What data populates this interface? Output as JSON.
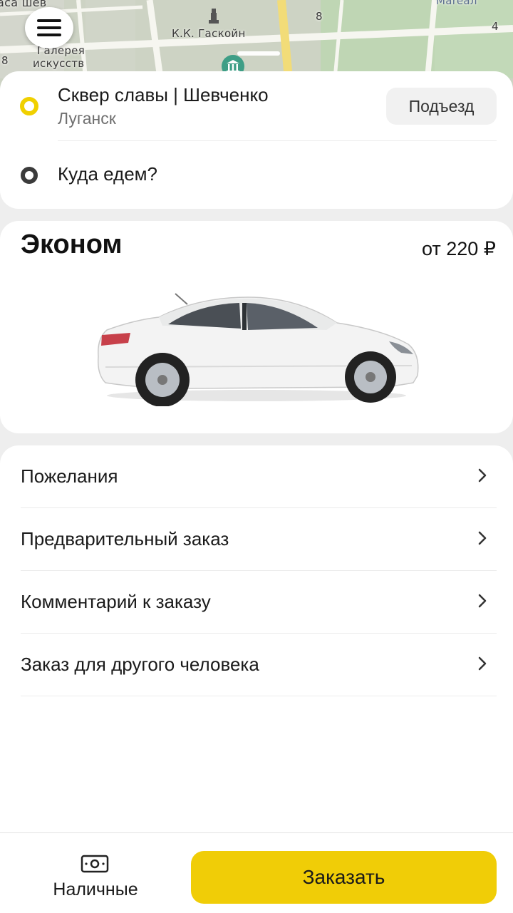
{
  "map": {
    "labels": {
      "top_left": "аса шев",
      "building": "К.К. Гаскойн",
      "gallery_line1": "Галерея",
      "gallery_line2": "искусств",
      "number_8a": "8",
      "number_8b": "8",
      "number_4": "4",
      "top_right": "Mareал"
    },
    "icons": [
      "menu-icon",
      "monument-icon",
      "museum-icon"
    ]
  },
  "route": {
    "from_title": "Сквер славы | Шевченко",
    "from_city": "Луганск",
    "entrance_label": "Подъезд",
    "to_placeholder": "Куда едем?"
  },
  "tariff": {
    "name": "Эконом",
    "price": "от 220 ₽"
  },
  "options": [
    {
      "label": "Пожелания"
    },
    {
      "label": "Предварительный заказ"
    },
    {
      "label": "Комментарий к заказу"
    },
    {
      "label": "Заказ для другого человека"
    }
  ],
  "footer": {
    "payment_label": "Наличные",
    "payment_icon": "cash-icon",
    "order_label": "Заказать"
  },
  "colors": {
    "accent_yellow": "#f0cd07",
    "from_marker": "#f0d000",
    "to_marker": "#3b3b3b"
  }
}
